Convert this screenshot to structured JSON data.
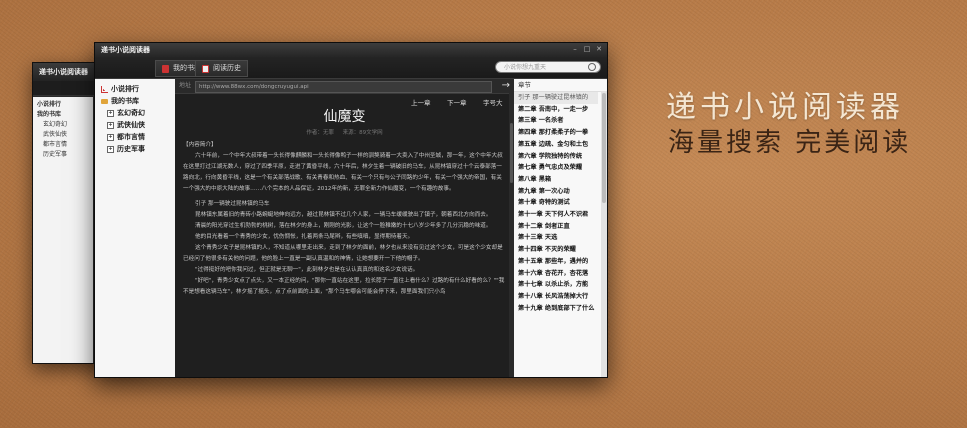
{
  "promo": {
    "headline": "递书小说阅读器",
    "tagline": "海量搜索  完美阅读"
  },
  "back_window": {
    "title": "递书小说阅读器",
    "sidebar": [
      "小说排行",
      "我的书库",
      "玄幻奇幻",
      "武侠仙侠",
      "都市言情",
      "历史军事"
    ]
  },
  "window": {
    "title": "递书小说阅读器",
    "toolbar": {
      "my_shelf": "我的书架",
      "history": "阅读历史",
      "search_placeholder": "小说你想九重天"
    },
    "sidebar": {
      "rank": "小说排行",
      "library": "我的书库",
      "categories": [
        "玄幻奇幻",
        "武侠仙侠",
        "都市言情",
        "历史军事"
      ]
    },
    "reader": {
      "url_label": "地址",
      "url": "http://www.88wx.com/dongcruyugui.api",
      "prev": "上一章",
      "next": "下一章",
      "font": "字号大",
      "book_title": "仙魔变",
      "meta_author": "作者：无罪",
      "meta_source": "来源：89文学网",
      "intro_label": "【内容简介】",
      "paragraphs": [
        "六十年前，一个中年大叔带着一头长得像麒麟和一头长得像鸭子一样的驯獒骑着一大卖入了中州圣城，那一年，这个中年大叔在这里打过江湖无数人，穿过了四季平原，走进了黄昏平线，六十年后，林夕生着一辆破旧的马车，从昆林镇穿过十个云泰部落一路向北，行向黄昏平线，这是一个有关部落战歌、有关青春和热血、有关一个只有与公子同路的少年，有关一个强大的帝国，有关一个强大的中原大陆的故事……八个完本的人品保证，2012年的新，无罪全新力作仙魔变，一个有趣的故事。",
        "引子  那一辆驶过昆林镇的马车",
        "昆林镇东属着旧的青砖小路蜿蜒地伸向远方，越过昆林镇不过几个人家，一辆马车缓缓驶出了镇子，朝着西北方向而去。",
        "清晨的阳光穿过生机勃勃的桃树，落在林夕的身上，刚刚的光影，让这个一脸稚嫩的十七八岁少年多了几分沉稳的味道。",
        "他的目光看着一个青秀的少女，忧伤惆怅，扎着两条马尾辫，有些嗔嗔，显得期待着天。",
        "这个青秀少女子是昆林镇的人，不知道从哪里走出来，走到了林夕的面前，林夕也从来没有见过这个少女，可是这个少女却是已经问了他很多有关他的问题，他的脸上一直是一副认真温和的神情，让她想要开一下他的帽子。",
        "\"过得挺好的吧你我问过，但正就是无聊一\"，此刻林夕也是在认认真真的和这名少女说话。",
        "\"好吧\"，青秀少女点了点头，又一本正经的问，\"那你一直站在这里，拉长脖子一直往上看什么？过路的有什么好看的么？\"\"我不是想看这辆马车\"，林夕摇了摇头，点了点前面的上面，\"那个马车哪会可能会停下来，那里面我们只小鸟"
      ]
    },
    "chapters": {
      "header": "章节",
      "items": [
        "引子  那一辆驶过昆林镇的",
        "第二章  吾南中，一走一步",
        "第三章  一名杀者",
        "第四章  那打柔柔子的一拳",
        "第五章  边疏、金匀和土包",
        "第六章  学院独特的传统",
        "第七章  勇气忠贞及荣耀",
        "第八章  黑箱",
        "第九章  第一次心动",
        "第十章  奇特的测试",
        "第十一章  天下何人不识君",
        "第十二章  剑者正直",
        "第十三章  天选",
        "第十四章  不灭的荣耀",
        "第十五章  那些年，遇并的",
        "第十六章  杏花开，杏花落",
        "第十七章  以杀止杀，方能",
        "第十八章  长风浩荡掉大行",
        "第十九章  绝到底部下了什么"
      ]
    }
  }
}
